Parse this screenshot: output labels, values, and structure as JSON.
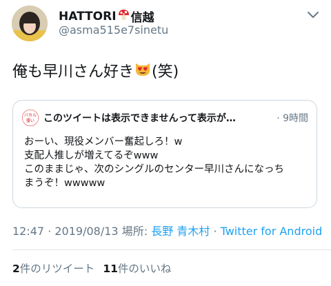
{
  "author": {
    "display_name": "HATTORI",
    "display_name_suffix": "信越",
    "handle": "@asma515e7sinetu"
  },
  "tweet": {
    "text_before_emoji": "俺も早川さん好き",
    "text_after_emoji": "(笑)"
  },
  "quote": {
    "avatar_text_top": "バカル",
    "avatar_text_bottom": "優い",
    "author_text": "このツイートは表示できませんって表示が…",
    "time": "· 9時間",
    "body_lines": [
      "おーい、現役メンバー奮起しろ！w",
      "支配人推しが増えてるぞwww",
      "このままじゃ、次のシングルのセンター早川さんになっち",
      "まうぞ！wwwww"
    ]
  },
  "meta": {
    "timestamp": "12:47 · 2019/08/13",
    "location_label": "場所:",
    "location": "長野 青木村",
    "separator": "·",
    "client": "Twitter for Android"
  },
  "stats": {
    "retweet_count": "2",
    "retweet_label": "件のリツイート",
    "like_count": "11",
    "like_label": "件のいいね"
  },
  "colors": {
    "link": "#1da1f2",
    "secondary_text": "#657786",
    "border": "#ccd6dd"
  }
}
